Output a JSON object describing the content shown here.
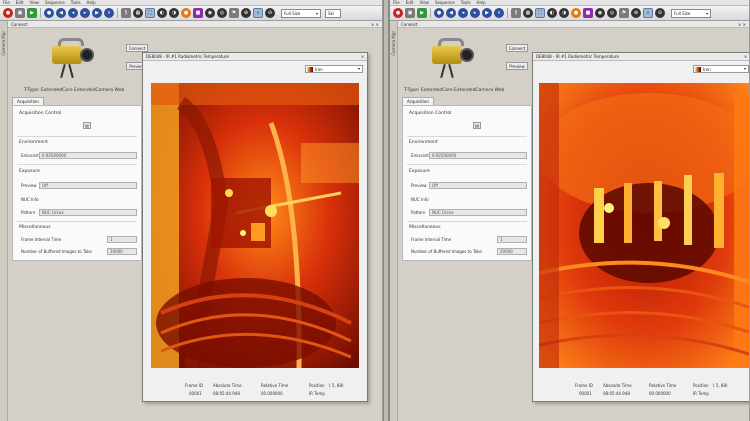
{
  "menu": [
    "File",
    "Edit",
    "View",
    "Sequence",
    "Tools",
    "Help"
  ],
  "toolbar": {
    "frame_rate_value": "Full Size",
    "small_combo_value": "Ski"
  },
  "dock": {
    "title": "Connect",
    "side_tab": "Camera Mgr",
    "connect_button": "Connect",
    "second_button": "Preview"
  },
  "camera_panel": {
    "title": "T-Type: ExtendedCore ExtendedCamera Web",
    "tab": "Acquisition",
    "acquisition_control": "Acquisition Control",
    "environment": "Environment",
    "emissivity_label": "Emissivity",
    "emissivity_value": "0.92500000",
    "exposure": "Exposure",
    "preview_label": "Preview",
    "preview_value": "Off",
    "nuc_label": "NUC Info",
    "pattern_label": "Pattern",
    "pattern_value": "NUC LVxxx",
    "miscellaneous": "Miscellaneous",
    "frames_label": "Frame Interval Time",
    "frames_value": "1",
    "buffer_label": "Number of Buffered Images to Take",
    "buffer_value": "20000"
  },
  "viewer_left": {
    "title": "DE8048 - IR #1 Radiometric Temperature",
    "palette": "Iron",
    "status": {
      "frame_label": "Frame ID",
      "frame_value": "00001",
      "abs_label": "Absolute Time",
      "abs_value": "08:05:44.948",
      "rel_label": "Relative Time",
      "rel_value": "00.000000",
      "pos_label": "Position",
      "pos_value": "(  5,  88)",
      "temp_value": "IR Temp"
    }
  },
  "viewer_right": {
    "title": "DE8048 - IR #1 Radiometric Temperature",
    "palette": "Iron",
    "status": {
      "frame_label": "Frame ID",
      "frame_value": "00001",
      "abs_label": "Absolute Time",
      "abs_value": "08:05:44.948",
      "rel_label": "Relative Time",
      "rel_value": "00.000000",
      "pos_label": "Position",
      "pos_value": "(  5,  88)",
      "temp_value": "IR Temp"
    }
  },
  "colors": {
    "thermal_hot": "#fff06a",
    "thermal_warm": "#ff7a10",
    "thermal_mid": "#d62a0a",
    "thermal_cold": "#5a0a00",
    "toolbar_blue": "#2c4f9e"
  }
}
